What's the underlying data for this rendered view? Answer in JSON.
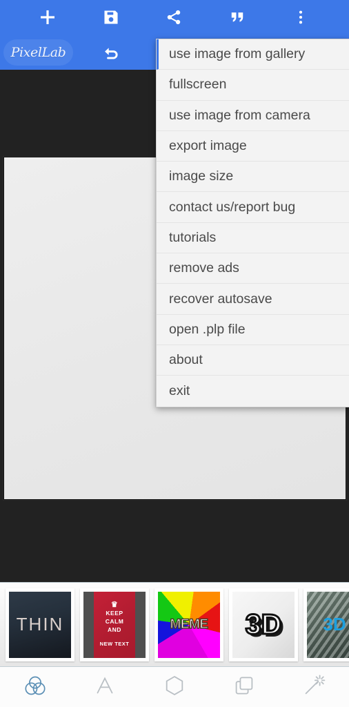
{
  "app": {
    "name": "PixelLab",
    "logo_text": "PixelLab",
    "accent_blue": "#3d78e8",
    "logo_chip_blue": "#4c83ea",
    "stage_background": "#222222",
    "canvas_color": "#ebebeb"
  },
  "toolbar": {
    "buttons": [
      {
        "name": "add-icon",
        "label": "add",
        "glyph": "plus"
      },
      {
        "name": "save-icon",
        "label": "save",
        "glyph": "floppy-disk"
      },
      {
        "name": "share-icon",
        "label": "share",
        "glyph": "share"
      },
      {
        "name": "quote-icon",
        "label": "quote",
        "glyph": "quotation-marks"
      },
      {
        "name": "more-options-icon",
        "label": "more options",
        "glyph": "vertical-dots"
      }
    ],
    "undo": {
      "name": "undo-icon",
      "label": "undo",
      "glyph": "undo-arrow"
    }
  },
  "menu": {
    "open": true,
    "highlighted_index": 0,
    "items": [
      {
        "label": "use image from gallery"
      },
      {
        "label": "fullscreen"
      },
      {
        "label": "use image from camera"
      },
      {
        "label": "export image"
      },
      {
        "label": "image size"
      },
      {
        "label": "contact us/report bug"
      },
      {
        "label": "tutorials"
      },
      {
        "label": "remove ads"
      },
      {
        "label": "recover autosave"
      },
      {
        "label": "open .plp file"
      },
      {
        "label": "about"
      },
      {
        "label": "exit"
      }
    ]
  },
  "templates": {
    "items": [
      {
        "name": "template-thin",
        "label": "THIN",
        "style": "thin"
      },
      {
        "name": "template-keep-calm",
        "style": "keep-calm",
        "crown": "♛",
        "line1": "KEEP",
        "line2": "CALM",
        "line3": "AND",
        "line4": "NEW TEXT"
      },
      {
        "name": "template-meme",
        "label": "MEME",
        "style": "meme"
      },
      {
        "name": "template-3d",
        "label": "3D",
        "style": "three-d"
      },
      {
        "name": "template-striped",
        "label": "3D",
        "style": "striped"
      }
    ]
  },
  "bottom_nav": {
    "active_index": 0,
    "active_color": "#5b8fb5",
    "inactive_color": "#b9bfc4",
    "items": [
      {
        "name": "nav-item-overlay",
        "label": "overlay"
      },
      {
        "name": "nav-item-text",
        "label": "text"
      },
      {
        "name": "nav-item-shape",
        "label": "shape"
      },
      {
        "name": "nav-item-duplicate",
        "label": "duplicate"
      },
      {
        "name": "nav-item-effects",
        "label": "effects"
      }
    ]
  }
}
